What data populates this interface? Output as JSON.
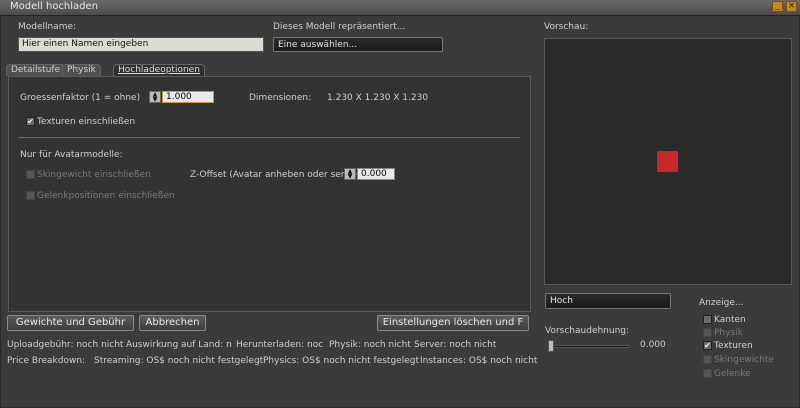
{
  "window": {
    "title": "Modell hochladen"
  },
  "name": {
    "label": "Modellname:",
    "value": "Hier einen Namen eingeben"
  },
  "represents": {
    "label": "Dieses Modell repräsentiert...",
    "value": "Eine auswählen..."
  },
  "tabs": [
    {
      "label": "Detailstufe"
    },
    {
      "label": "Physik"
    },
    {
      "label": "Hochladeoptionen"
    }
  ],
  "scale": {
    "label": "Groessenfaktor (1 = ohne)",
    "value": "1.000"
  },
  "dimensions": {
    "label": "Dimensionen:",
    "value": "1.230 X 1.230 X 1.230"
  },
  "textures_checkbox": {
    "label": "Texturen einschließen",
    "checked": true
  },
  "avatar_section": {
    "label": "Nur für Avatarmodelle:",
    "weights_label": "Skingewicht einschließen",
    "joints_label": "Gelenkpositionen einschließen",
    "zoffset_label": "Z-Offset (Avatar anheben oder senke",
    "zoffset_value": "0.000"
  },
  "buttons": {
    "weights_fee": "Gewichte und Gebühr",
    "cancel": "Abbrechen",
    "clear_settings": "Einstellungen löschen und F"
  },
  "fees_row": {
    "upload": "Uploadgebühr: noch nicht",
    "land_impact": "Auswirkung auf Land: n",
    "download": "Herunterladen: noc",
    "physics": "Physik: noch nicht",
    "server": "Server: noch nicht"
  },
  "breakdown_row": {
    "label": "Price Breakdown:",
    "streaming": "Streaming: OS$ noch nicht festgelegt",
    "physics": "Physics: OS$ noch nicht festgelegt",
    "instances": "Instances: OS$ noch nicht"
  },
  "preview": {
    "label": "Vorschau:",
    "lod_value": "Hoch",
    "stretch_label": "Vorschaudehnung:",
    "stretch_value": "0.000",
    "model_color": "#c8282a"
  },
  "display": {
    "label": "Anzeige...",
    "options": [
      {
        "label": "Kanten",
        "checked": false,
        "enabled": true
      },
      {
        "label": "Physik",
        "checked": false,
        "enabled": false
      },
      {
        "label": "Texturen",
        "checked": true,
        "enabled": true
      },
      {
        "label": "Skingewichte",
        "checked": false,
        "enabled": false
      },
      {
        "label": "Gelenke",
        "checked": false,
        "enabled": false
      }
    ]
  }
}
